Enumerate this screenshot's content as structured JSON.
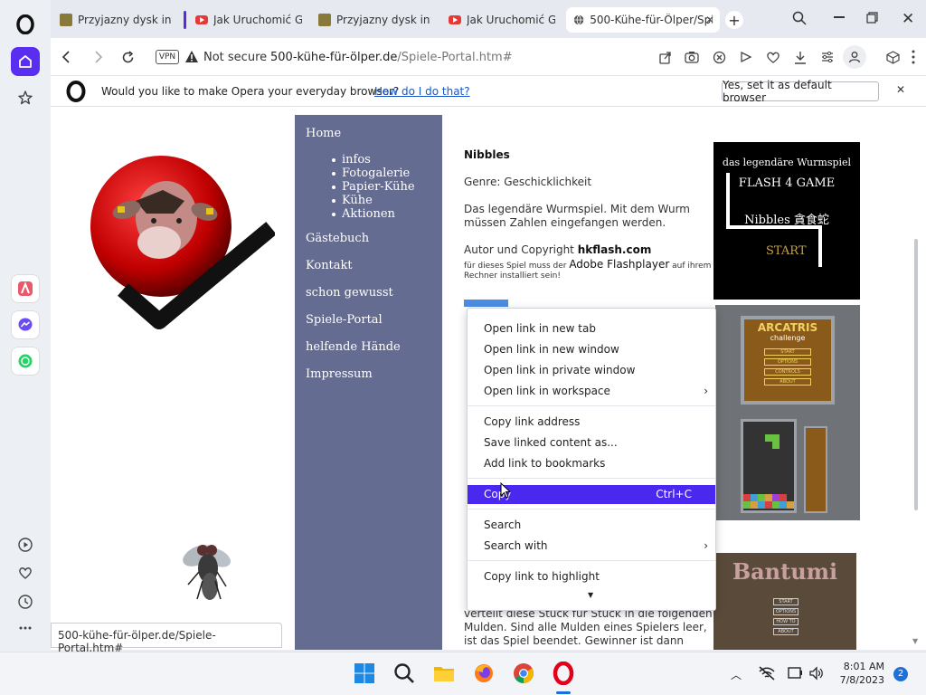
{
  "sidebar": {
    "icons": [
      "opera-logo-icon",
      "home-icon",
      "star-icon",
      "aria-icon",
      "messenger-icon",
      "whatsapp-icon",
      "player-icon",
      "heart-icon",
      "history-icon",
      "more-icon"
    ]
  },
  "tabs": [
    {
      "label": "Przyjazny dysk intern",
      "favicon": "cow"
    },
    {
      "label": "Jak Uruchomić Grę Fl",
      "favicon": "youtube"
    },
    {
      "label": "Przyjazny dysk intern",
      "favicon": "cow"
    },
    {
      "label": "Jak Uruchomić Grę Fl",
      "favicon": "youtube"
    },
    {
      "label": "500-Kühe-für-Ölper/Spiele",
      "favicon": "globe",
      "active": true
    }
  ],
  "address": {
    "vpn": "VPN",
    "security": "Not secure",
    "host": "500-kühe-für-ölper.de",
    "path": "/Spiele-Portal.htm#"
  },
  "infobar": {
    "question": "Would you like to make Opera your everyday browser?",
    "link": "How do I do that?",
    "button": "Yes, set it as default browser"
  },
  "nav": {
    "home": "Home",
    "sub": [
      "infos",
      "Fotogalerie",
      "Papier-Kühe",
      "Kühe",
      "Aktionen"
    ],
    "items": [
      "Gästebuch",
      "Kontakt",
      "schon gewusst",
      "Spiele-Portal",
      "helfende Hände",
      "Impressum"
    ]
  },
  "content": {
    "title": "Nibbles",
    "genre": "Genre: Geschicklichkeit",
    "desc1": "Das legendäre Wurmspiel. Mit dem Wurm",
    "desc2": "müssen Zahlen eingefangen werden.",
    "author_prefix": "Autor und Copyright ",
    "author": "hkflash.com",
    "note_prefix": "für dieses Spiel muss der ",
    "note_flash": "Adobe Flashplayer",
    "note_suffix": " auf ihrem",
    "note2": "Rechner installiert sein!",
    "selected_link": "ARCATRIS",
    "bottom1": "verteilt diese Stück für Stück in die folgenden",
    "bottom2": "Mulden. Sind alle Mulden eines Spielers leer,",
    "bottom3": "ist das Spiel beendet. Gewinner ist dann"
  },
  "games": {
    "nibbles": {
      "line1": "das legendäre Wurmspiel",
      "line2": "FLASH 4 GAME",
      "line3": "Nibbles 貪食蛇",
      "line4": "START"
    },
    "arcatris": {
      "title": "ARCATRIS",
      "subtitle": "challenge",
      "menu": [
        "START",
        "OPTIONS",
        "CONTROLS",
        "ABOUT"
      ]
    },
    "bantumi": {
      "title": "Bantumi",
      "menu": [
        "START",
        "OPTIONS",
        "HOW TO",
        "ABOUT"
      ]
    }
  },
  "context_menu": {
    "items": [
      {
        "label": "Open link in new tab"
      },
      {
        "label": "Open link in new window"
      },
      {
        "label": "Open link in private window"
      },
      {
        "label": "Open link in workspace",
        "submenu": true
      },
      {
        "label": "Copy link address"
      },
      {
        "label": "Save linked content as..."
      },
      {
        "label": "Add link to bookmarks"
      },
      {
        "label": "Copy",
        "shortcut": "Ctrl+C",
        "highlighted": true
      },
      {
        "label": "Search"
      },
      {
        "label": "Search with",
        "submenu": true
      },
      {
        "label": "Copy link to highlight"
      }
    ]
  },
  "status_url": "500-kühe-für-ölper.de/Spiele-Portal.htm#",
  "taskbar": {
    "time": "8:01 AM",
    "date": "7/8/2023",
    "notifications": "2"
  },
  "colors": {
    "accent": "#4a28f0",
    "nav_bg": "#656c92",
    "opera_red": "#e3001b"
  }
}
